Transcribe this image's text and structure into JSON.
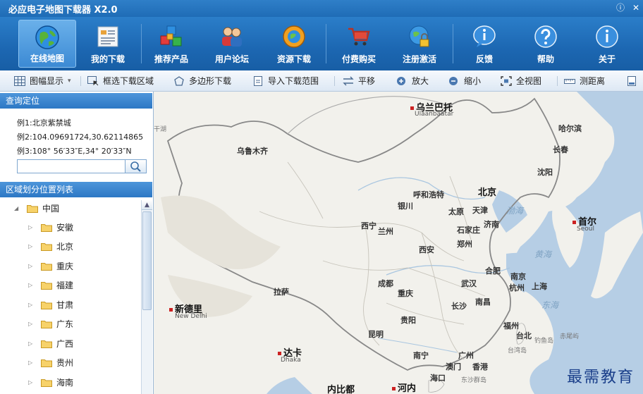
{
  "app": {
    "title": "必应电子地图下载器 X2.0",
    "info_btn": "ⓘ",
    "close_btn": "✕"
  },
  "toolbar": [
    {
      "label": "在线地图",
      "icon": "globe-icon",
      "active": true
    },
    {
      "label": "我的下载",
      "icon": "download-list-icon",
      "active": false
    },
    {
      "label": "推荐产品",
      "icon": "cubes-icon",
      "active": false
    },
    {
      "label": "用户论坛",
      "icon": "users-icon",
      "active": false
    },
    {
      "label": "资源下载",
      "icon": "resource-globe-icon",
      "active": false
    },
    {
      "label": "付费购买",
      "icon": "cart-icon",
      "active": false
    },
    {
      "label": "注册激活",
      "icon": "lock-globe-icon",
      "active": false
    },
    {
      "label": "反馈",
      "icon": "info-bubble-icon",
      "active": false
    },
    {
      "label": "帮助",
      "icon": "help-icon",
      "active": false
    },
    {
      "label": "关于",
      "icon": "about-icon",
      "active": false
    }
  ],
  "strip": {
    "frame_display": "图幅显示",
    "frame_display_arrow": "▾",
    "box_select": "框选下载区域",
    "polygon": "多边形下载",
    "import_range": "导入下载范围",
    "pan": "平移",
    "zoom_in": "放大",
    "zoom_out": "缩小",
    "full_view": "全视图",
    "measure": "测距离"
  },
  "left": {
    "query_header": "查询定位",
    "example1": "例1:北京紫禁城",
    "example2": "例2:104.09691724,30.62114865",
    "example3": "例3:108° 56′33″E,34° 20′33″N",
    "search_value": "",
    "region_header": "区域划分位置列表",
    "tree_root": "中国",
    "tree_root_toggle": "◢",
    "tree_child_toggle": "▷",
    "scroll_up": "▲",
    "provinces": [
      "安徽",
      "北京",
      "重庆",
      "福建",
      "甘肃",
      "广东",
      "广西",
      "贵州",
      "海南"
    ]
  },
  "map": {
    "cities": [
      {
        "name": "乌兰巴托",
        "big": true,
        "red": true
      },
      {
        "name": "哈尔滨",
        "big": false,
        "red": false
      },
      {
        "name": "长春",
        "big": false,
        "red": false
      },
      {
        "name": "乌鲁木齐",
        "big": false,
        "red": false
      },
      {
        "name": "沈阳",
        "big": false,
        "red": false
      },
      {
        "name": "呼和浩特",
        "big": false,
        "red": false
      },
      {
        "name": "北京",
        "big": true,
        "red": true
      },
      {
        "name": "银川",
        "big": false,
        "red": false
      },
      {
        "name": "太原",
        "big": false,
        "red": false
      },
      {
        "name": "天津",
        "big": false,
        "red": false
      },
      {
        "name": "首尔",
        "big": true,
        "red": true
      },
      {
        "name": "西宁",
        "big": false,
        "red": false
      },
      {
        "name": "兰州",
        "big": false,
        "red": false
      },
      {
        "name": "石家庄",
        "big": false,
        "red": false
      },
      {
        "name": "济南",
        "big": false,
        "red": false
      },
      {
        "name": "郑州",
        "big": false,
        "red": false
      },
      {
        "name": "西安",
        "big": false,
        "red": false
      },
      {
        "name": "合肥",
        "big": false,
        "red": false
      },
      {
        "name": "南京",
        "big": false,
        "red": false
      },
      {
        "name": "杭州",
        "big": false,
        "red": false
      },
      {
        "name": "上海",
        "big": false,
        "red": false
      },
      {
        "name": "成都",
        "big": false,
        "red": false
      },
      {
        "name": "武汉",
        "big": false,
        "red": false
      },
      {
        "name": "拉萨",
        "big": false,
        "red": false
      },
      {
        "name": "重庆",
        "big": false,
        "red": false
      },
      {
        "name": "长沙",
        "big": false,
        "red": false
      },
      {
        "name": "南昌",
        "big": false,
        "red": false
      },
      {
        "name": "新德里",
        "big": true,
        "red": true
      },
      {
        "name": "贵阳",
        "big": false,
        "red": false
      },
      {
        "name": "福州",
        "big": false,
        "red": false
      },
      {
        "name": "台北",
        "big": false,
        "red": false
      },
      {
        "name": "昆明",
        "big": false,
        "red": false
      },
      {
        "name": "达卡",
        "big": true,
        "red": true
      },
      {
        "name": "南宁",
        "big": false,
        "red": false
      },
      {
        "name": "广州",
        "big": false,
        "red": false
      },
      {
        "name": "澳门",
        "big": false,
        "red": false
      },
      {
        "name": "香港",
        "big": false,
        "red": false
      },
      {
        "name": "海口",
        "big": false,
        "red": false
      },
      {
        "name": "内比都",
        "big": true,
        "red": false
      },
      {
        "name": "河内",
        "big": true,
        "red": true
      }
    ],
    "en_labels": [
      "Ulaanbaatar",
      "Seoul",
      "New Delhi",
      "Dhaka"
    ],
    "seas": [
      "渤海",
      "黄海",
      "东海"
    ],
    "small_labels": [
      "干湖",
      "钓鱼岛",
      "赤尾屿",
      "台湾岛",
      "东沙群岛"
    ],
    "watermark": "最需教育"
  }
}
